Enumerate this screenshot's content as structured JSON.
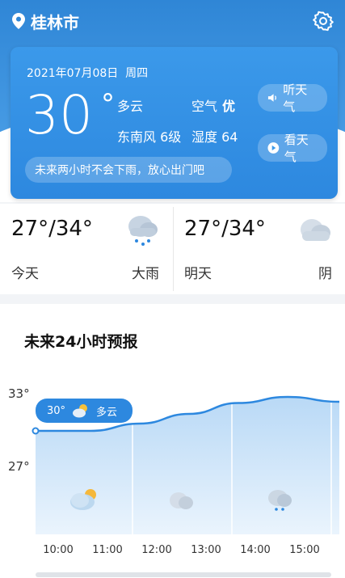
{
  "header": {
    "city": "桂林市"
  },
  "current": {
    "date": "2021年07月08日",
    "weekday": "周四",
    "temp": "30",
    "condition": "多云",
    "wind": "东南风 6级",
    "air_label": "空气",
    "air_value": "优",
    "humidity": "湿度 64",
    "listen_label": "听天气",
    "watch_label": "看天气",
    "notice": "未来两小时不会下雨，放心出门吧"
  },
  "daily": [
    {
      "range": "27°/34°",
      "label": "今天",
      "condition": "大雨",
      "icon": "rain-cloud-icon"
    },
    {
      "range": "27°/34°",
      "label": "明天",
      "condition": "阴",
      "icon": "overcast-cloud-icon"
    }
  ],
  "forecast": {
    "title": "未来24小时预报",
    "y_labels": [
      "33°",
      "27°"
    ],
    "bubble": {
      "temp": "30°",
      "condition": "多云"
    },
    "hours": [
      "10:00",
      "11:00",
      "12:00",
      "13:00",
      "14:00",
      "15:00"
    ],
    "hour_icons": [
      "partly-cloudy-icon",
      "cloud-icon",
      "rain-cloud-icon"
    ]
  },
  "chart_data": {
    "type": "area",
    "x": [
      "10:00",
      "11:00",
      "12:00",
      "13:00",
      "14:00",
      "15:00"
    ],
    "series": [
      {
        "values": [
          30,
          30.6,
          31.4,
          32.3,
          32.8,
          32.4
        ]
      }
    ],
    "ylim": [
      25,
      34
    ],
    "yticks": [
      27,
      33
    ]
  },
  "colors": {
    "accent": "#2d88df",
    "header": "#2f86d6"
  }
}
